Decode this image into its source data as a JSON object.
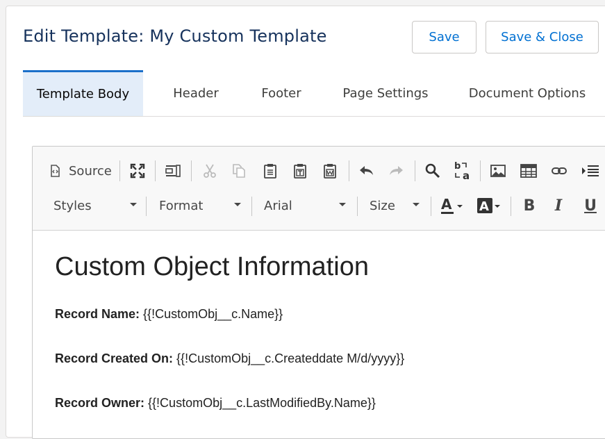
{
  "header": {
    "title": "Edit Template: My Custom Template",
    "save_label": "Save",
    "save_close_label": "Save & Close"
  },
  "tabs": [
    {
      "label": "Template Body",
      "active": true
    },
    {
      "label": "Header",
      "active": false
    },
    {
      "label": "Footer",
      "active": false
    },
    {
      "label": "Page Settings",
      "active": false
    },
    {
      "label": "Document Options",
      "active": false
    }
  ],
  "toolbar": {
    "source_label": "Source",
    "row1_icons": [
      "source-icon",
      "maximize-icon",
      "show-blocks-icon",
      "cut-icon",
      "copy-icon",
      "paste-icon",
      "paste-text-icon",
      "paste-from-word-icon",
      "undo-icon",
      "redo-icon",
      "find-icon",
      "replace-icon",
      "image-icon",
      "table-icon",
      "link-icon",
      "indent-icon"
    ],
    "combos": {
      "styles": "Styles",
      "format": "Format",
      "font": "Arial",
      "size": "Size"
    },
    "row2_icons": [
      "text-color-icon",
      "background-color-icon",
      "bold-icon",
      "italic-icon",
      "underline-icon"
    ]
  },
  "document": {
    "heading": "Custom Object Information",
    "fields": [
      {
        "label": "Record Name:",
        "value": " {{!CustomObj__c.Name}}"
      },
      {
        "label": "Record Created On:",
        "value": " {{!CustomObj__c.Createddate M/d/yyyy}}"
      },
      {
        "label": "Record Owner:",
        "value": " {{!CustomObj__c.LastModifiedBy.Name}}"
      }
    ]
  },
  "colors": {
    "title": "#16325c",
    "button_text": "#0070d2",
    "active_tab_bg": "#e3edf9",
    "active_tab_border": "#1b6fc9"
  }
}
